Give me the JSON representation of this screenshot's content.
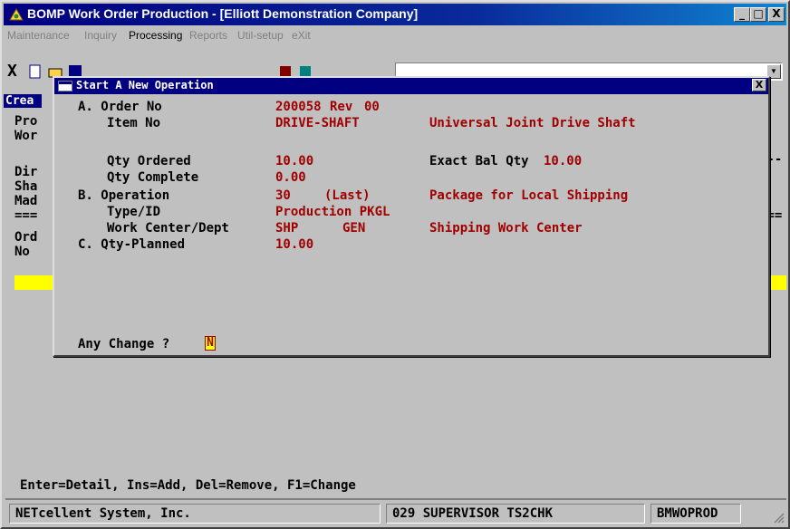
{
  "window": {
    "title": "BOMP Work Order Production - [Elliott Demonstration Company]",
    "controls": {
      "minimize": "_",
      "maximize": "□",
      "close": "X"
    }
  },
  "menu": [
    {
      "label": "Maintenance",
      "active": false
    },
    {
      "label": "Inquiry",
      "active": false
    },
    {
      "label": "Processing",
      "active": true
    },
    {
      "label": "Reports",
      "active": false
    },
    {
      "label": "Util-setup",
      "active": false
    },
    {
      "label": "eXit",
      "active": false
    }
  ],
  "toolbar": {
    "close_glyph": "X"
  },
  "background": {
    "partial_labels": [
      "Crea",
      "Pro",
      "Wor",
      "Dir",
      "Sha",
      "Mad",
      "===",
      "Ord",
      "No"
    ],
    "right_fragments": [
      "y--",
      "==="
    ]
  },
  "help_line": "Enter=Detail, Ins=Add, Del=Remove, F1=Change",
  "status_bar": {
    "company": "NETcellent System, Inc.",
    "user": "029 SUPERVISOR TS2CHK",
    "program": "BMWOPROD"
  },
  "dialog": {
    "title": "Start A New Operation",
    "close": "X",
    "fields": {
      "order_no_label": "A. Order No",
      "order_no": "200058",
      "rev_label": "Rev",
      "rev": "00",
      "item_no_label": "Item No",
      "item_no": "DRIVE-SHAFT",
      "item_desc": "Universal Joint Drive Shaft",
      "qty_ordered_label": "Qty Ordered",
      "qty_ordered": "10.00",
      "exact_bal_label": "Exact Bal Qty",
      "exact_bal": "10.00",
      "qty_complete_label": "Qty Complete",
      "qty_complete": "0.00",
      "operation_label": "B. Operation",
      "operation": "30",
      "operation_last": "(Last)",
      "operation_desc": "Package for Local Shipping",
      "type_id_label": "Type/ID",
      "type_id": "Production PKGL",
      "work_center_label": "Work Center/Dept",
      "work_center": "SHP",
      "dept": "GEN",
      "work_center_desc": "Shipping Work Center",
      "qty_planned_label": "C. Qty-Planned",
      "qty_planned": "10.00",
      "any_change_label": "Any Change ?",
      "any_change_value": "N"
    }
  },
  "colors": {
    "titlebar": "#000080",
    "value_text": "#a00000",
    "highlight": "#ffff00",
    "face": "#c0c0c0"
  }
}
